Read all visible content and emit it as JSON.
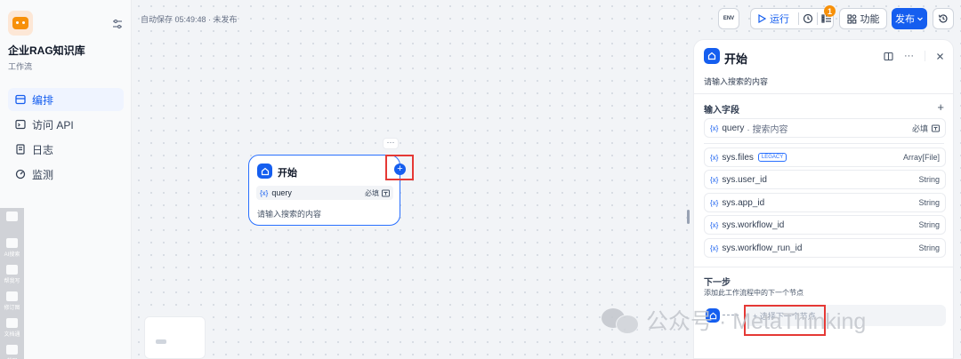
{
  "app": {
    "name": "企业RAG知识库",
    "type": "工作流"
  },
  "nav": [
    {
      "label": "编排",
      "icon": "layout-icon"
    },
    {
      "label": "访问 API",
      "icon": "terminal-icon"
    },
    {
      "label": "日志",
      "icon": "log-icon"
    },
    {
      "label": "监测",
      "icon": "monitor-icon"
    }
  ],
  "vert_toolbar": [
    "AI搜索",
    "帮我写",
    "修订图",
    "文档通",
    "截图"
  ],
  "autosave": "自动保存 05:49:48 · 未发布",
  "toolbar": {
    "env_label": "ENV",
    "run_label": "运行",
    "badge_count": "1",
    "features_label": "功能",
    "publish_label": "发布"
  },
  "node": {
    "more": "···",
    "title": "开始",
    "var_symbol": "{x}",
    "var_name": "query",
    "required": "必填",
    "description": "请输入搜索的内容",
    "add": "+"
  },
  "panel": {
    "title": "开始",
    "description": "请输入搜索的内容",
    "input_section": "输入字段",
    "plus": "+",
    "user_field": {
      "name": "query",
      "label": "· 搜索内容",
      "required": "必填"
    },
    "system_fields": [
      {
        "name": "sys.files",
        "tag": "LEGACY",
        "type": "Array[File]"
      },
      {
        "name": "sys.user_id",
        "type": "String"
      },
      {
        "name": "sys.app_id",
        "type": "String"
      },
      {
        "name": "sys.workflow_id",
        "type": "String"
      },
      {
        "name": "sys.workflow_run_id",
        "type": "String"
      }
    ],
    "next_title": "下一步",
    "next_desc": "添加此工作流程中的下一个节点",
    "next_slot": "+ 选择下一个节点"
  },
  "watermark": "公众号 · MetaThinking",
  "colors": {
    "accent": "#155eef",
    "highlight_box": "#e53935",
    "badge": "#f79009"
  }
}
